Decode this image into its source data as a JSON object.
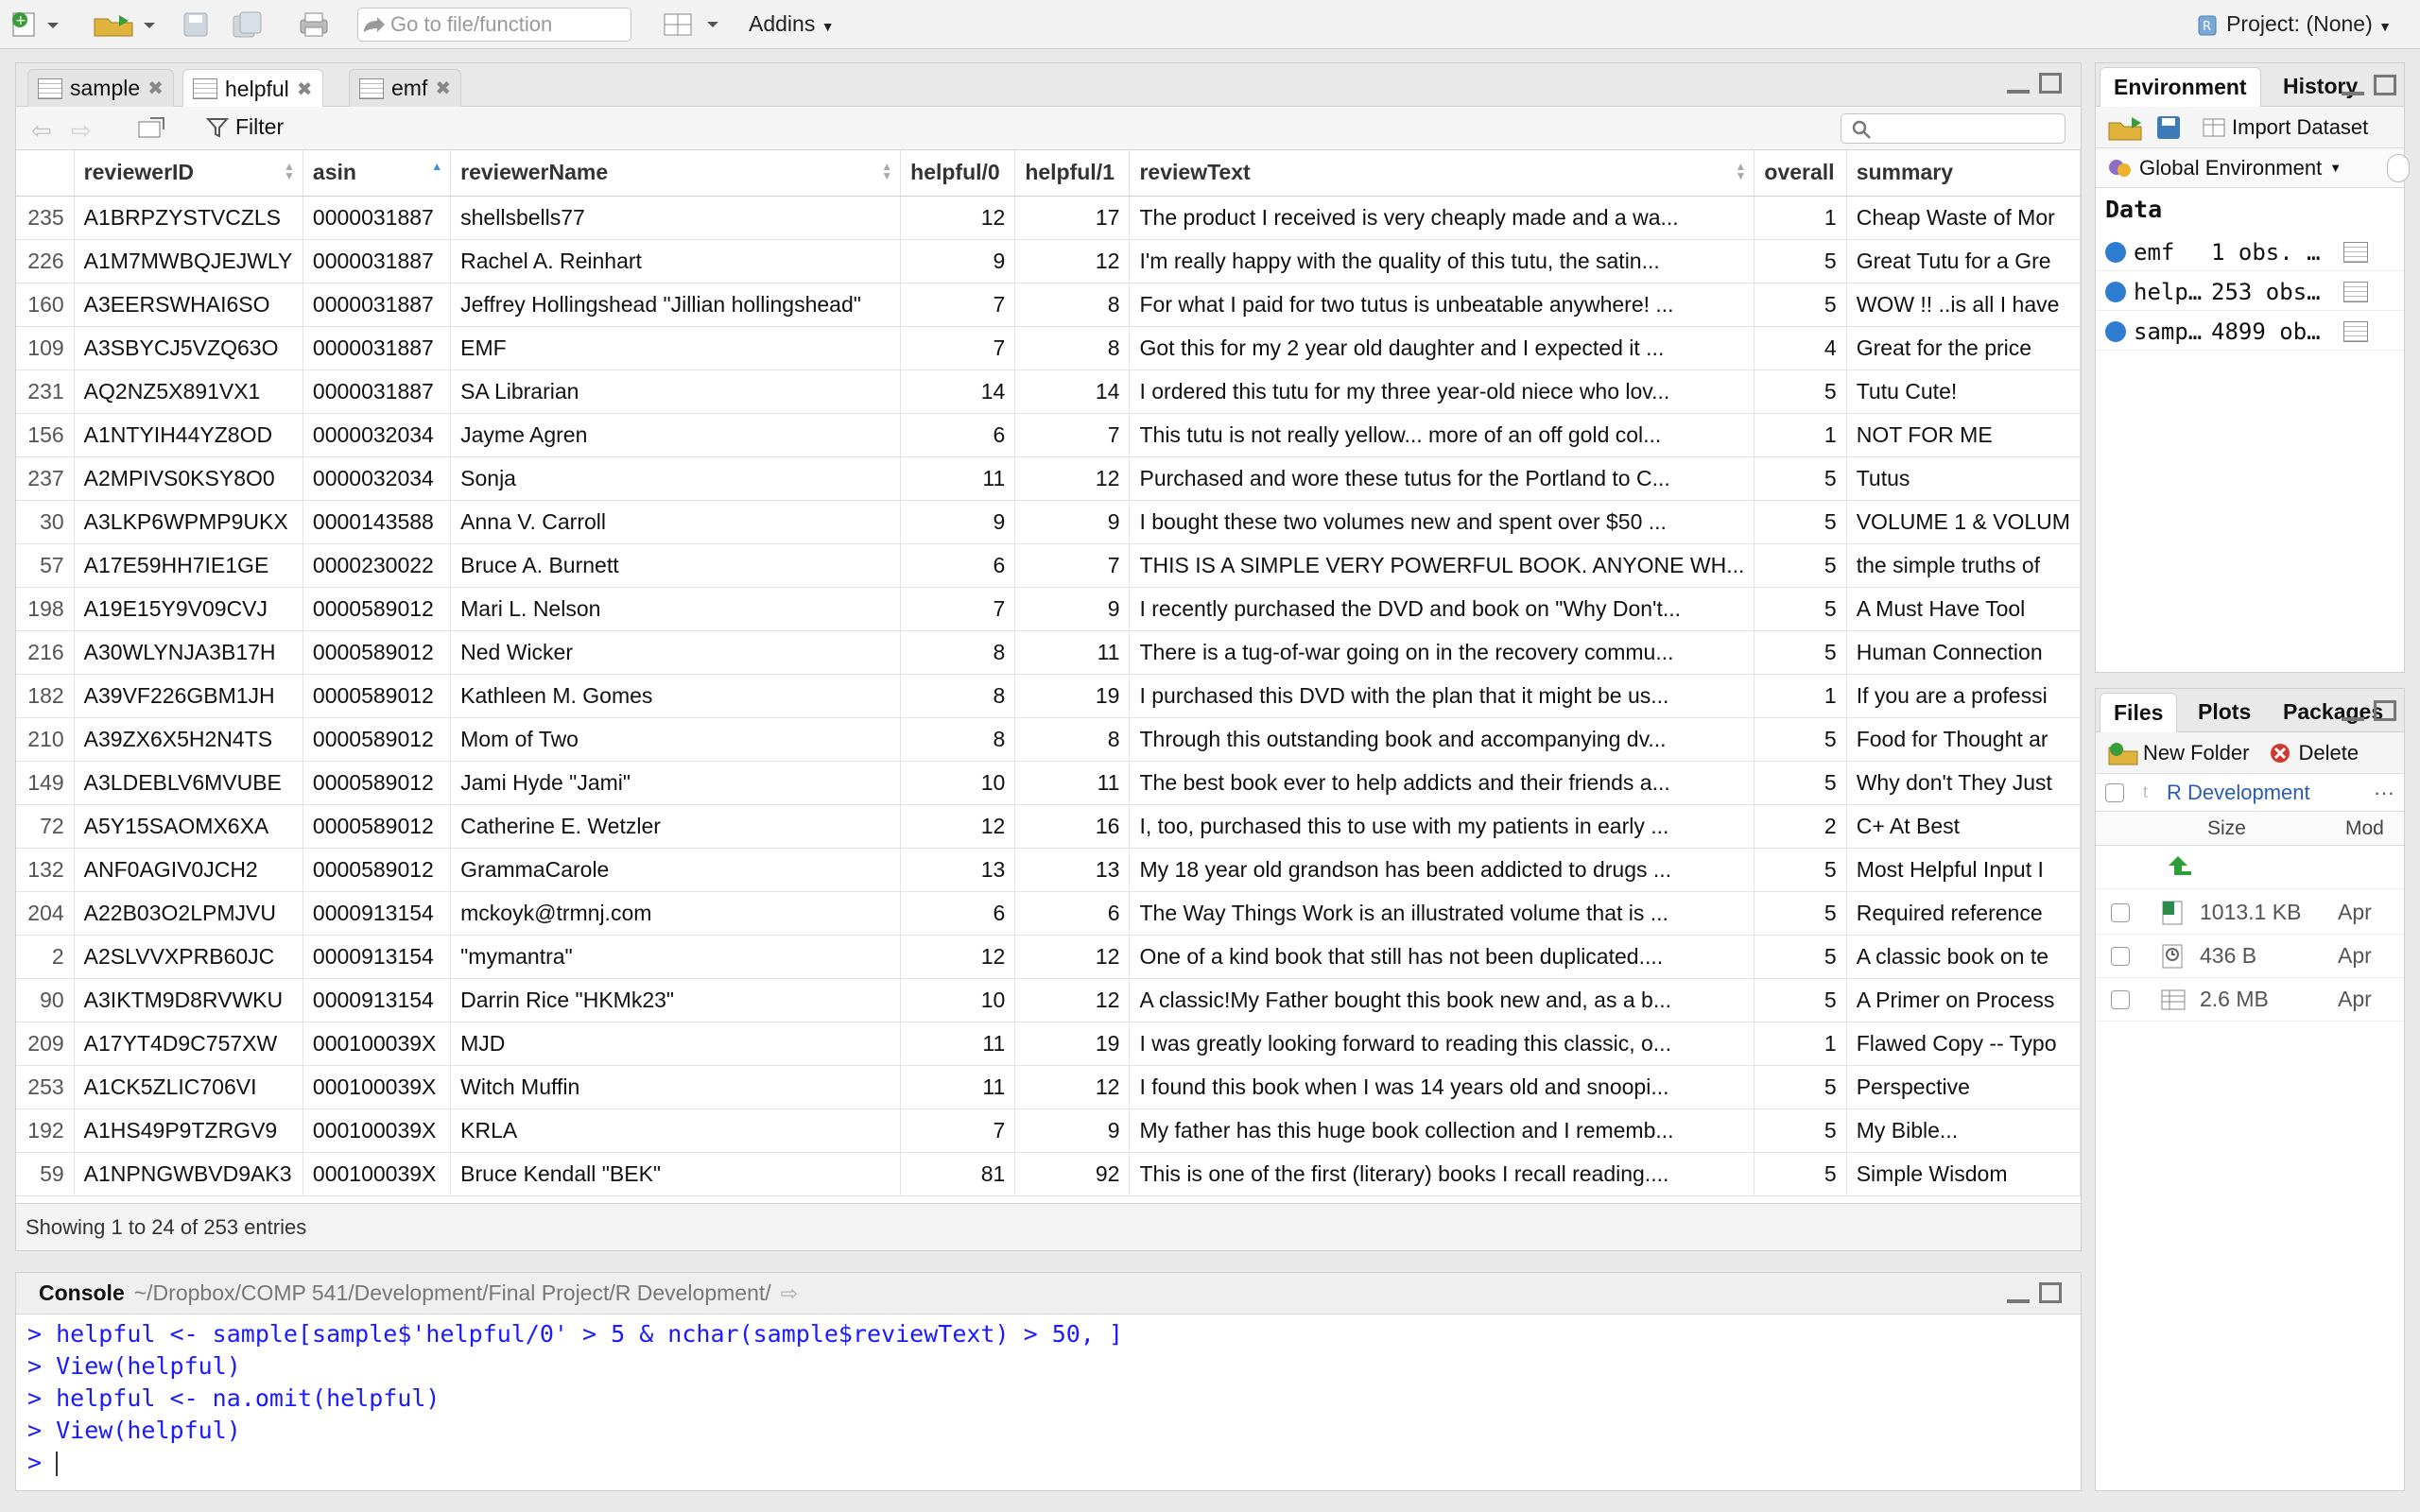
{
  "toolbar": {
    "goto_placeholder": "Go to file/function",
    "addins_label": "Addins",
    "project_label": "Project: (None)"
  },
  "viewer": {
    "tabs": [
      {
        "label": "sample",
        "active": false
      },
      {
        "label": "helpful",
        "active": true
      },
      {
        "label": "emf",
        "active": false
      }
    ],
    "filter_label": "Filter",
    "columns": [
      "reviewerID",
      "asin",
      "reviewerName",
      "helpful/0",
      "helpful/1",
      "reviewText",
      "overall",
      "summary"
    ],
    "rows": [
      [
        "235",
        "A1BRPZYSTVCZLS",
        "0000031887",
        "shellsbells77",
        "12",
        "17",
        "The product I received is very cheaply made and a wa...",
        "1",
        "Cheap Waste of Mor"
      ],
      [
        "226",
        "A1M7MWBQJEJWLY",
        "0000031887",
        "Rachel A. Reinhart",
        "9",
        "12",
        "I'm really happy with the quality of this tutu, the satin...",
        "5",
        "Great Tutu for a Gre"
      ],
      [
        "160",
        "A3EERSWHAI6SO",
        "0000031887",
        "Jeffrey Hollingshead \"Jillian hollingshead\"",
        "7",
        "8",
        "For what I paid for two tutus is unbeatable anywhere! ...",
        "5",
        "WOW !! ..is all I have"
      ],
      [
        "109",
        "A3SBYCJ5VZQ63O",
        "0000031887",
        "EMF",
        "7",
        "8",
        "Got this for my 2 year old daughter and I expected it ...",
        "4",
        "Great for the price"
      ],
      [
        "231",
        "AQ2NZ5X891VX1",
        "0000031887",
        "SA Librarian",
        "14",
        "14",
        "I ordered this tutu for my three year-old niece who lov...",
        "5",
        "Tutu Cute!"
      ],
      [
        "156",
        "A1NTYIH44YZ8OD",
        "0000032034",
        "Jayme Agren",
        "6",
        "7",
        "This tutu is not really yellow... more of an off gold col...",
        "1",
        "NOT FOR ME"
      ],
      [
        "237",
        "A2MPIVS0KSY8O0",
        "0000032034",
        "Sonja",
        "11",
        "12",
        "Purchased and wore these tutus for the Portland to C...",
        "5",
        "Tutus"
      ],
      [
        "30",
        "A3LKP6WPMP9UKX",
        "0000143588",
        "Anna V. Carroll",
        "9",
        "9",
        "I bought these two volumes new and spent over $50 ...",
        "5",
        "VOLUME 1 & VOLUM"
      ],
      [
        "57",
        "A17E59HH7IE1GE",
        "0000230022",
        "Bruce A. Burnett",
        "6",
        "7",
        "THIS IS A SIMPLE VERY POWERFUL BOOK. ANYONE WH...",
        "5",
        "the simple truths of"
      ],
      [
        "198",
        "A19E15Y9V09CVJ",
        "0000589012",
        "Mari L. Nelson",
        "7",
        "9",
        "I recently purchased the DVD and book on \"Why Don't...",
        "5",
        "A Must Have Tool"
      ],
      [
        "216",
        "A30WLYNJA3B17H",
        "0000589012",
        "Ned Wicker",
        "8",
        "11",
        "There is a tug-of-war going on in the recovery commu...",
        "5",
        "Human Connection"
      ],
      [
        "182",
        "A39VF226GBM1JH",
        "0000589012",
        "Kathleen M. Gomes",
        "8",
        "19",
        "I purchased this DVD with the plan that it might be us...",
        "1",
        "If you are a professi"
      ],
      [
        "210",
        "A39ZX6X5H2N4TS",
        "0000589012",
        "Mom of Two",
        "8",
        "8",
        "Through this outstanding book and accompanying dv...",
        "5",
        "Food for Thought ar"
      ],
      [
        "149",
        "A3LDEBLV6MVUBE",
        "0000589012",
        "Jami Hyde \"Jami\"",
        "10",
        "11",
        "The best book ever to help addicts and their friends a...",
        "5",
        "Why don't They Just"
      ],
      [
        "72",
        "A5Y15SAOMX6XA",
        "0000589012",
        "Catherine E. Wetzler",
        "12",
        "16",
        "I, too, purchased this to use with my patients in early ...",
        "2",
        "C+ At Best"
      ],
      [
        "132",
        "ANF0AGIV0JCH2",
        "0000589012",
        "GrammaCarole",
        "13",
        "13",
        "My 18 year old grandson has been addicted to drugs ...",
        "5",
        "Most Helpful Input I"
      ],
      [
        "204",
        "A22B03O2LPMJVU",
        "0000913154",
        "mckoyk@trmnj.com",
        "6",
        "6",
        "The Way Things Work is an illustrated volume that is ...",
        "5",
        "Required reference"
      ],
      [
        "2",
        "A2SLVVXPRB60JC",
        "0000913154",
        "\"mymantra\"",
        "12",
        "12",
        "One of a kind book that still has not been duplicated....",
        "5",
        "A classic book on te"
      ],
      [
        "90",
        "A3IKTM9D8RVWKU",
        "0000913154",
        "Darrin Rice \"HKMk23\"",
        "10",
        "12",
        "A classic!My Father bought this book new and, as a b...",
        "5",
        "A Primer on Process"
      ],
      [
        "209",
        "A17YT4D9C757XW",
        "000100039X",
        "MJD",
        "11",
        "19",
        "I was greatly looking forward to reading this classic, o...",
        "1",
        "Flawed Copy -- Typo"
      ],
      [
        "253",
        "A1CK5ZLIC706VI",
        "000100039X",
        "Witch Muffin",
        "11",
        "12",
        "I found this book when I was 14 years old and snoopi...",
        "5",
        "Perspective"
      ],
      [
        "192",
        "A1HS49P9TZRGV9",
        "000100039X",
        "KRLA",
        "7",
        "9",
        "My father has this huge book collection and I rememb...",
        "5",
        "My Bible..."
      ],
      [
        "59",
        "A1NPNGWBVD9AK3",
        "000100039X",
        "Bruce Kendall \"BEK\"",
        "81",
        "92",
        "This is one of the first (literary) books I recall reading....",
        "5",
        "Simple Wisdom"
      ]
    ],
    "status": "Showing 1 to 24 of 253 entries"
  },
  "console": {
    "title": "Console",
    "path": "~/Dropbox/COMP 541/Development/Final Project/R Development/",
    "lines": [
      "> helpful <- sample[sample$'helpful/0' > 5 & nchar(sample$reviewText) > 50, ]",
      "> View(helpful)",
      "> helpful <- na.omit(helpful)",
      "> View(helpful)",
      ">"
    ]
  },
  "environment": {
    "tabs": [
      "Environment",
      "History"
    ],
    "import_label": "Import Dataset",
    "scope_label": "Global Environment",
    "section_label": "Data",
    "items": [
      {
        "name": "emf",
        "value": "1 obs. …"
      },
      {
        "name": "help…",
        "value": "253 obs…"
      },
      {
        "name": "samp…",
        "value": "4899 ob…"
      }
    ]
  },
  "files": {
    "tabs": [
      "Files",
      "Plots",
      "Packages"
    ],
    "new_folder_label": "New Folder",
    "delete_label": "Delete",
    "breadcrumb": "R Development",
    "col_size": "Size",
    "col_modified": "Mod",
    "rows": [
      {
        "size": "1013.1 KB",
        "mod": "Apr"
      },
      {
        "size": "436 B",
        "mod": "Apr"
      },
      {
        "size": "2.6 MB",
        "mod": "Apr"
      }
    ]
  }
}
